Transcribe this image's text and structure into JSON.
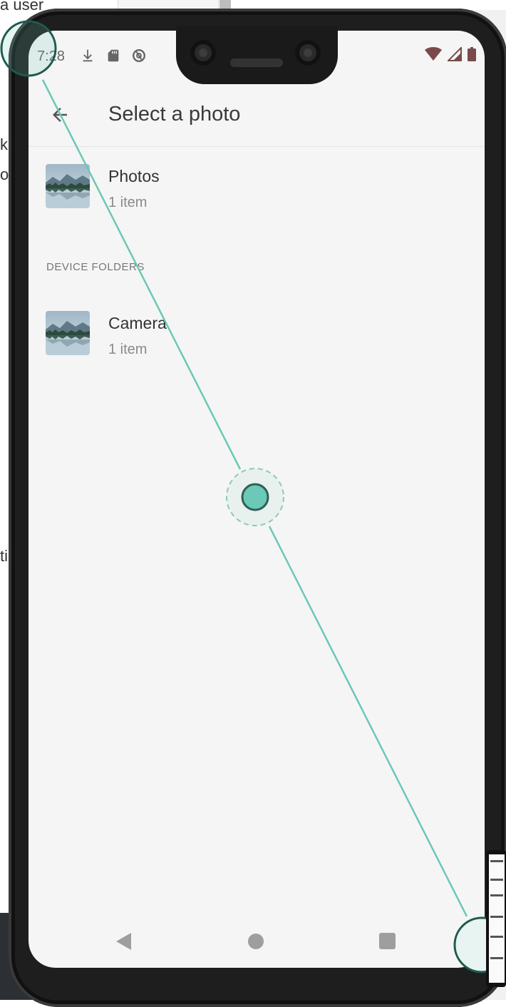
{
  "background": {
    "fragments": [
      "a user",
      "k,",
      "o",
      "ti"
    ]
  },
  "status_bar": {
    "time": "7:28",
    "icons_left": [
      "download-icon",
      "sd-card-icon",
      "data-saver-icon"
    ],
    "icons_right": [
      "wifi-icon",
      "signal-icon",
      "battery-icon"
    ]
  },
  "app_bar": {
    "title": "Select a photo",
    "back_icon": "arrow-back-icon"
  },
  "albums": [
    {
      "title": "Photos",
      "count": "1 item"
    }
  ],
  "device_folders": {
    "header": "DEVICE FOLDERS",
    "items": [
      {
        "title": "Camera",
        "count": "1 item"
      }
    ]
  },
  "nav_bar": {
    "icons": [
      "nav-back-icon",
      "nav-home-icon",
      "nav-recents-icon"
    ]
  },
  "colors": {
    "screen_bg": "#f5f5f5",
    "touch_accent": "#6cc8b7",
    "touch_outline": "#1f5a50",
    "nav_icon": "#9e9e9e"
  }
}
